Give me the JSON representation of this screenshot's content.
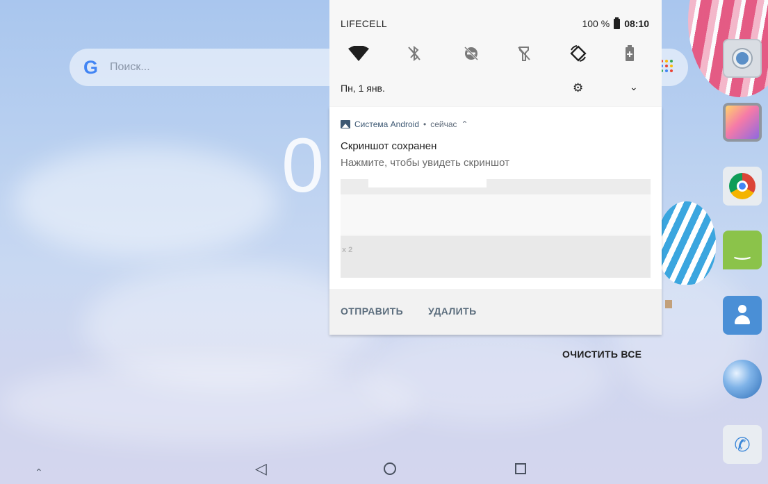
{
  "status_bar": {
    "carrier": "LIFECELL",
    "battery": "100 %",
    "time": "08:10"
  },
  "quick_settings": {
    "tiles": [
      "wifi-icon",
      "bluetooth-off-icon",
      "do-not-disturb-off-icon",
      "flashlight-off-icon",
      "auto-rotate-icon",
      "battery-saver-icon"
    ],
    "date": "Пн, 1 янв."
  },
  "notification": {
    "app_name": "Система Android",
    "time": "сейчас",
    "title": "Скриншот сохранен",
    "text": "Нажмите, чтобы увидеть скриншот",
    "preview_text": "x 2",
    "actions": {
      "send": "ОТПРАВИТЬ",
      "delete": "УДАЛИТЬ"
    }
  },
  "clear_all": "ОЧИСТИТЬ ВСЕ",
  "home": {
    "search_logo": "G",
    "search_placeholder": "Поиск...",
    "clock_partial": "0"
  },
  "dock_apps": [
    "camera-icon",
    "gallery-icon",
    "chrome-icon",
    "messaging-icon",
    "contacts-icon",
    "browser-icon",
    "phone-icon"
  ],
  "colors": {
    "accent": "#3d5873",
    "google_blue": "#4285f4"
  }
}
